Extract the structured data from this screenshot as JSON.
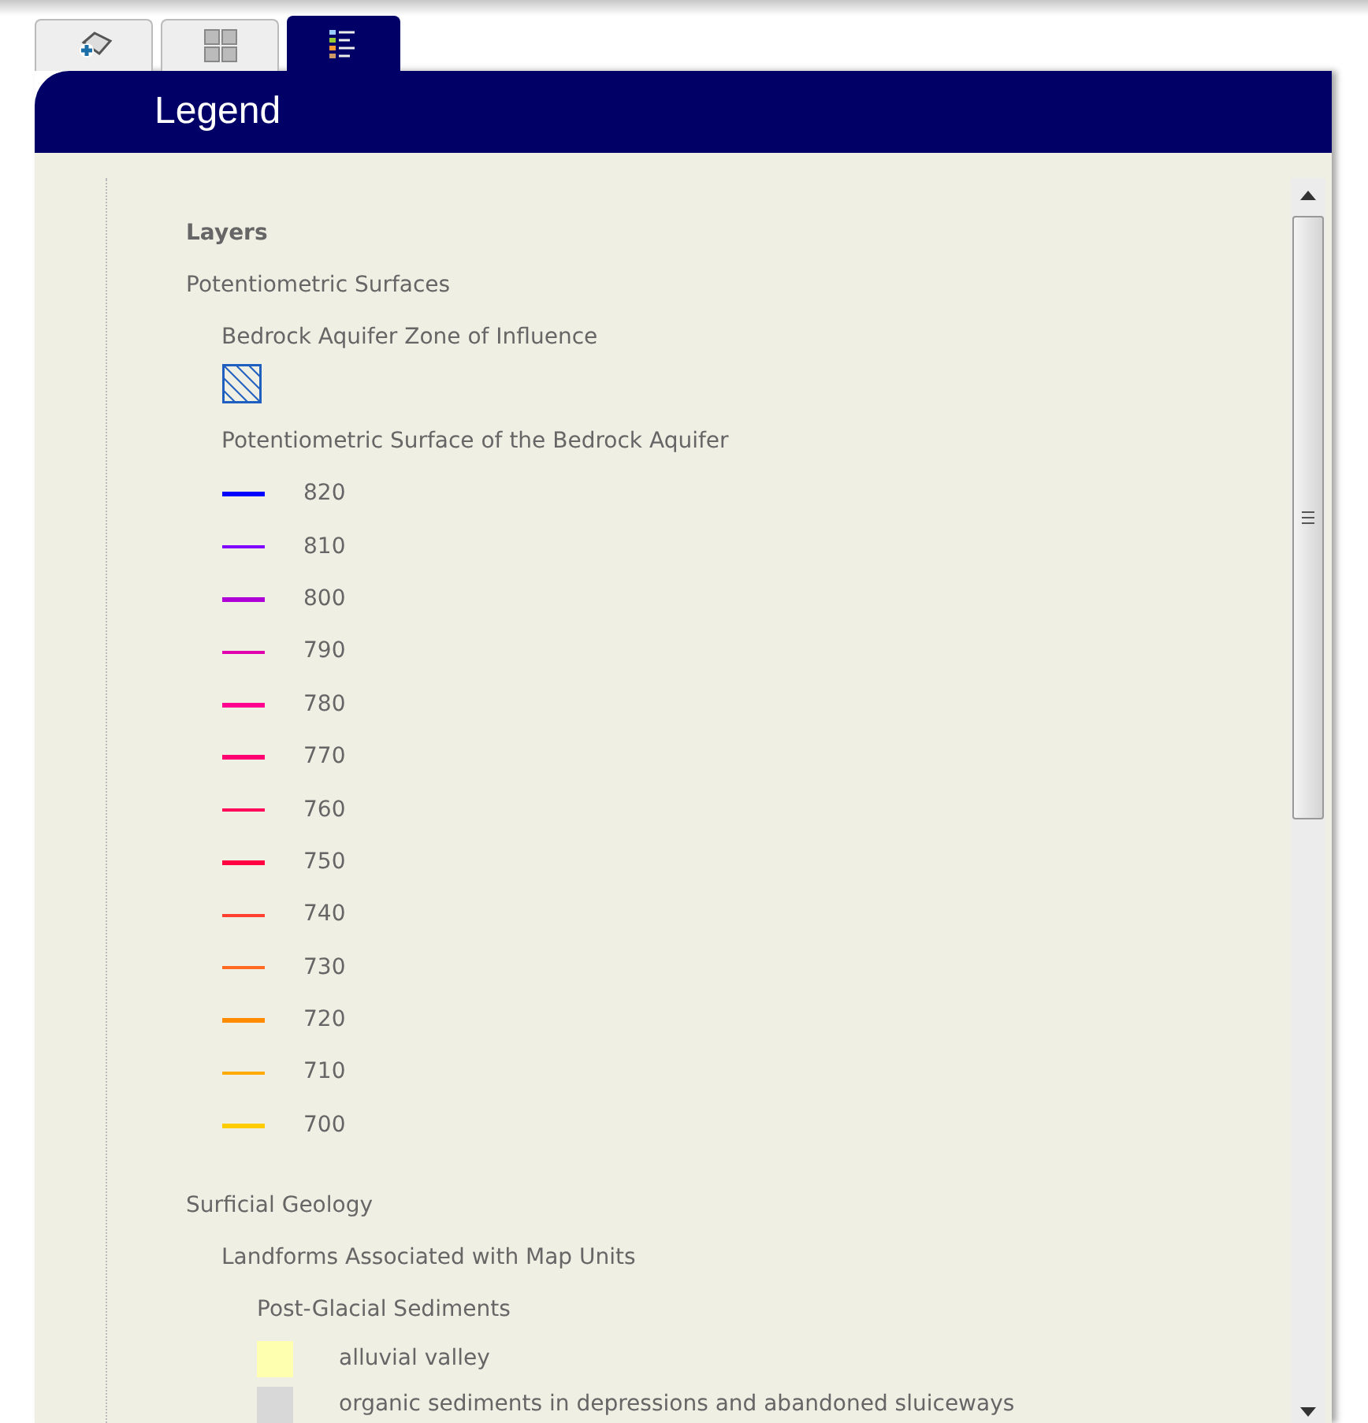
{
  "tabs": [
    {
      "kind": "add",
      "selected": false
    },
    {
      "kind": "grid",
      "selected": false
    },
    {
      "kind": "legend",
      "selected": true
    }
  ],
  "panel": {
    "title": "Legend"
  },
  "legend": {
    "heading": "Layers",
    "children": [
      {
        "label": "Potentiometric Surfaces",
        "children": [
          {
            "label": "Bedrock Aquifer Zone of Influence",
            "symbols": [
              {
                "kind": "hatch",
                "color": "#1f5fbf"
              }
            ]
          },
          {
            "label": "Potentiometric Surface of the Bedrock Aquifer",
            "symbols": [
              {
                "kind": "line",
                "color": "#0000ff",
                "label": "820"
              },
              {
                "kind": "line",
                "color": "#8000ff",
                "label": "810"
              },
              {
                "kind": "line",
                "color": "#b000d8",
                "label": "800"
              },
              {
                "kind": "line",
                "color": "#e000b0",
                "label": "790"
              },
              {
                "kind": "line",
                "color": "#ff0090",
                "label": "780"
              },
              {
                "kind": "line",
                "color": "#ff0070",
                "label": "770"
              },
              {
                "kind": "line",
                "color": "#ff0058",
                "label": "760"
              },
              {
                "kind": "line",
                "color": "#ff0040",
                "label": "750"
              },
              {
                "kind": "line",
                "color": "#ff4030",
                "label": "740"
              },
              {
                "kind": "line",
                "color": "#ff6a20",
                "label": "730"
              },
              {
                "kind": "line",
                "color": "#ff8c00",
                "label": "720"
              },
              {
                "kind": "line",
                "color": "#ffaa00",
                "label": "710"
              },
              {
                "kind": "line",
                "color": "#ffcc00",
                "label": "700"
              }
            ]
          }
        ]
      },
      {
        "label": "Surficial Geology",
        "children": [
          {
            "label": "Landforms Associated with Map Units",
            "children": [
              {
                "label": "Post-Glacial Sediments",
                "symbols": [
                  {
                    "kind": "fill",
                    "color": "#ffffb0",
                    "label": "alluvial valley"
                  },
                  {
                    "kind": "fill",
                    "color": "#d8d8d8",
                    "label": "organic sediments in depressions and abandoned sluiceways"
                  }
                ]
              }
            ]
          }
        ]
      }
    ]
  }
}
